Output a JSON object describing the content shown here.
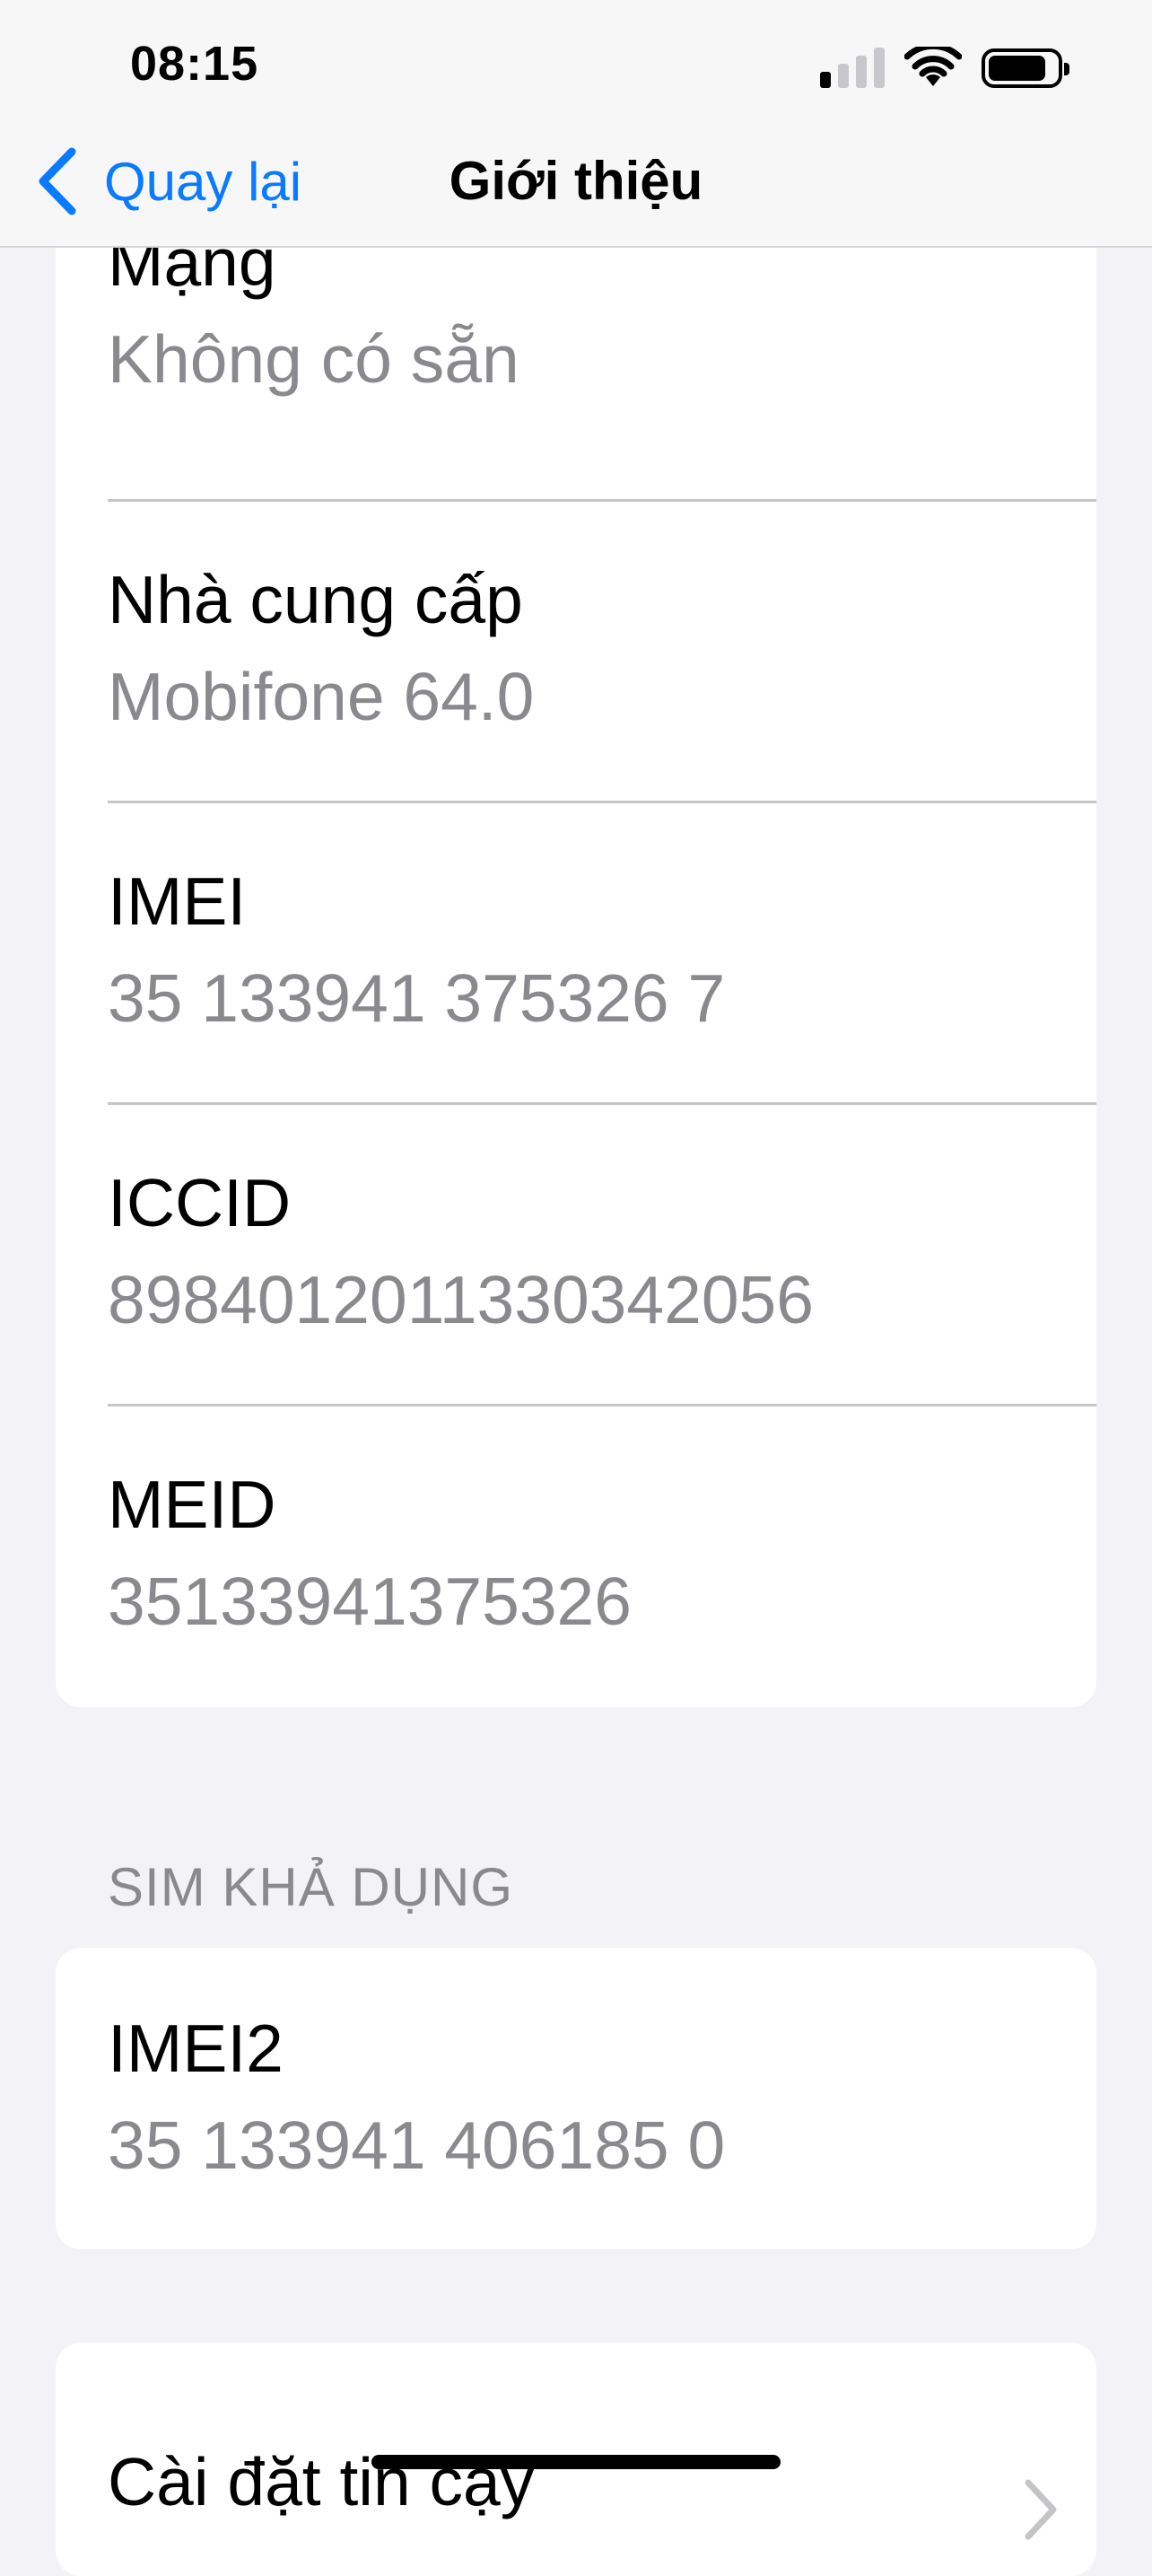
{
  "status_bar": {
    "time": "08:15",
    "signal_bars_filled": 1,
    "signal_bars_total": 4,
    "battery_level": 0.85
  },
  "nav": {
    "back_label": "Quay lại",
    "title": "Giới thiệu"
  },
  "info_rows": [
    {
      "label": "Mạng",
      "value": "Không có sẵn"
    },
    {
      "label": "Nhà cung cấp",
      "value": "Mobifone 64.0"
    },
    {
      "label": "IMEI",
      "value": "35 133941 375326 7"
    },
    {
      "label": "ICCID",
      "value": "8984012011330342056"
    },
    {
      "label": "MEID",
      "value": "35133941375326"
    }
  ],
  "sim_section": {
    "header": "SIM KHẢ DỤNG",
    "rows": [
      {
        "label": "IMEI2",
        "value": "35 133941 406185 0"
      }
    ]
  },
  "trust_item": {
    "label": "Cài đặt tin cậy"
  },
  "icons": {
    "back": "chevron-left-icon",
    "signal": "cellular-signal-icon",
    "wifi": "wifi-icon",
    "battery": "battery-icon",
    "disclosure": "chevron-right-icon"
  },
  "colors": {
    "accent": "#0A7AFF",
    "background": "#F2F2F7",
    "secondary_text": "#8A8A8E",
    "card": "#FFFFFF"
  }
}
